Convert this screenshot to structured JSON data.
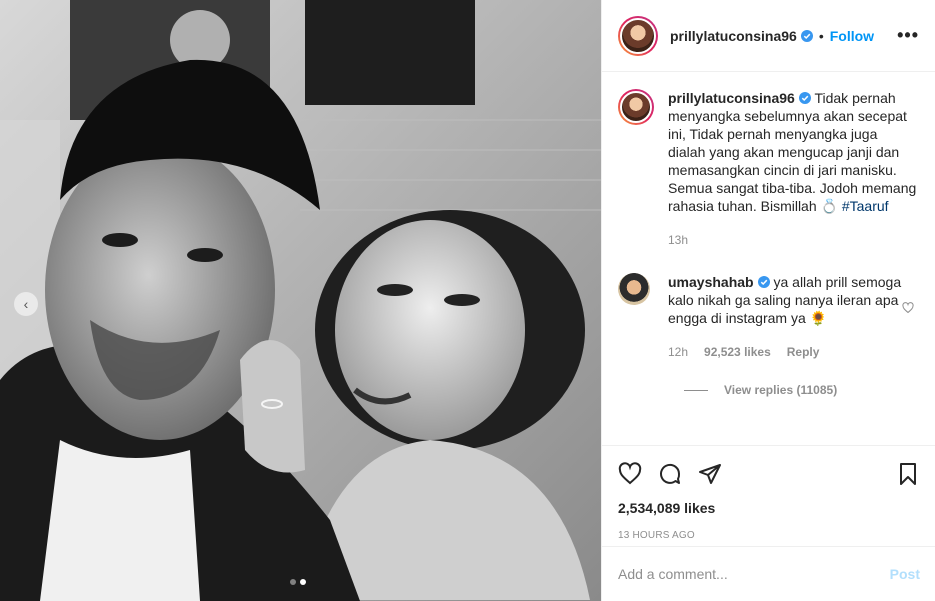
{
  "post": {
    "username": "prillylatuconsina96",
    "follow_label": "Follow",
    "separator": "•",
    "more_label": "•••",
    "carousel_prev": "‹",
    "caption": "Tidak pernah menyangka sebelumnya akan secepat ini, Tidak pernah menyangka juga dialah yang akan mengucap janji dan memasangkan cincin di jari manisku. Semua sangat tiba-tiba. Jodoh memang rahasia tuhan. Bismillah 💍",
    "hashtag": "#Taaruf",
    "caption_time": "13h",
    "likes": "2,534,089 likes",
    "timestamp": "13 HOURS AGO"
  },
  "top_comment": {
    "username": "umayshahab",
    "text": "ya allah prill semoga kalo nikah ga saling nanya ileran apa engga di instagram ya 🌻",
    "time": "12h",
    "likes": "92,523 likes",
    "reply_label": "Reply",
    "view_replies": "View replies (11085)"
  },
  "comment_box": {
    "placeholder": "Add a comment...",
    "post_label": "Post"
  },
  "colors": {
    "accent": "#0095f6",
    "hashtag": "#00376b",
    "muted": "#8e8e8e",
    "post_disabled": "#b2dffc"
  },
  "icons": [
    "chevron-left-icon",
    "verified-icon",
    "more-icon",
    "heart-icon",
    "comment-icon",
    "share-icon",
    "bookmark-icon"
  ]
}
